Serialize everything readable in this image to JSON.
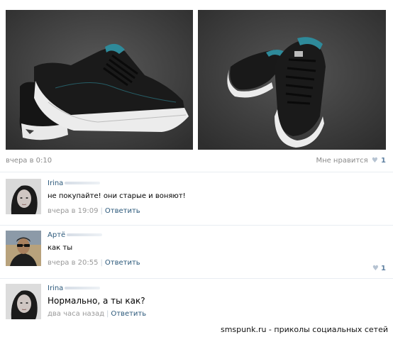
{
  "post": {
    "date": "вчера в 0:10",
    "like_label": "Мне нравится",
    "like_heart": "♥",
    "like_count": "1"
  },
  "comments": [
    {
      "author": "Irina",
      "text": "не покупайте! они старые и воняют!",
      "time": "вчера в 19:09",
      "reply": "Ответить"
    },
    {
      "author": "Артё",
      "text": "как ты",
      "time": "вчера в 20:55",
      "reply": "Ответить",
      "like_heart": "♥",
      "like_count": "1"
    },
    {
      "author": "Irina",
      "text": "Нормально, а ты как?",
      "time": "два часа назад",
      "reply": "Ответить"
    }
  ],
  "separator": "|",
  "watermark": "smspunk.ru - приколы социальных сетей",
  "colors": {
    "link": "#2b587a",
    "meta": "#999999",
    "photo_bg": "#3d3d3d",
    "shoe_teal": "#2e8a9a"
  },
  "icons": {
    "heart": "heart-icon"
  }
}
